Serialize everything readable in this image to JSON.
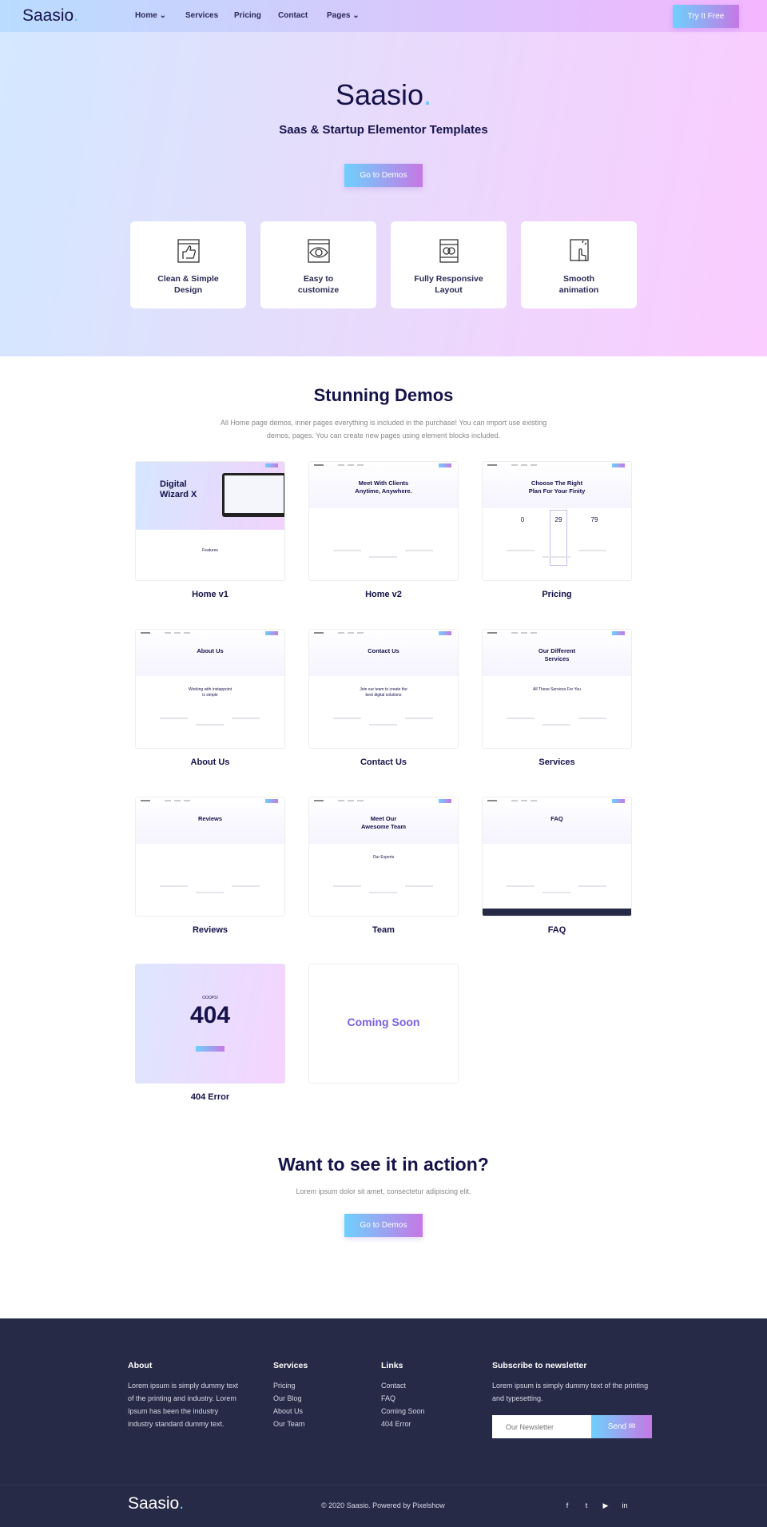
{
  "nav": {
    "logo": "Saasio",
    "logo_dot": ".",
    "items": [
      {
        "label": "Home",
        "dropdown": true
      },
      {
        "label": "Services"
      },
      {
        "label": "Pricing"
      },
      {
        "label": "Contact"
      },
      {
        "label": "Pages",
        "dropdown": true
      }
    ],
    "cta": "Try It Free"
  },
  "hero": {
    "title": "Saasio",
    "title_dot": ".",
    "subtitle": "Saas & Startup Elementor Templates",
    "button": "Go to Demos",
    "features": [
      {
        "icon": "thumbs-up-icon",
        "label": "Clean & Simple\nDesign"
      },
      {
        "icon": "eye-icon",
        "label": "Easy to\ncustomize"
      },
      {
        "icon": "responsive-layout-icon",
        "label": "Fully Responsive\nLayout"
      },
      {
        "icon": "touch-animation-icon",
        "label": "Smooth\nanimation"
      }
    ]
  },
  "demos": {
    "title": "Stunning Demos",
    "description": "All Home page demos, inner pages everything is included in the purchase! You can import use existing demos, pages. You can create new pages using element blocks included.",
    "items": [
      {
        "label": "Home v1",
        "heading": "Digital\nWizard X",
        "sub": "Features"
      },
      {
        "label": "Home v2",
        "heading": "Meet With Clients\nAnytime, Anywhere."
      },
      {
        "label": "Pricing",
        "heading": "Choose The Right\nPlan For Your Finity",
        "prices": [
          "0",
          "29",
          "79"
        ]
      },
      {
        "label": "About Us",
        "heading": "About Us",
        "sub": "Working with instappoint\nis simple"
      },
      {
        "label": "Contact Us",
        "heading": "Contact Us",
        "sub": "Join our team to create the\nbest digital solutions"
      },
      {
        "label": "Services",
        "heading": "Our Different\nServices",
        "sub": "All These Services For You"
      },
      {
        "label": "Reviews",
        "heading": "Reviews"
      },
      {
        "label": "Team",
        "heading": "Meet Our\nAwesome Team",
        "sub": "Our Experts"
      },
      {
        "label": "FAQ",
        "heading": "FAQ"
      },
      {
        "label": "404 Error",
        "heading": "404",
        "sub": "OOOPS!"
      },
      {
        "label": "",
        "heading": "Coming Soon"
      }
    ]
  },
  "cta": {
    "title": "Want to see it in action?",
    "text": "Lorem ipsum dolor sit amet, consectetur adipiscing elit.",
    "button": "Go to Demos"
  },
  "footer": {
    "about": {
      "title": "About",
      "text": "Lorem ipsum is simply dummy text of the printing and industry. Lorem Ipsum has been the industry industry standard dummy text."
    },
    "services": {
      "title": "Services",
      "links": [
        "Pricing",
        "Our Blog",
        "About Us",
        "Our Team"
      ]
    },
    "links": {
      "title": "Links",
      "links": [
        "Contact",
        "FAQ",
        "Coming Soon",
        "404 Error"
      ]
    },
    "newsletter": {
      "title": "Subscribe to newsletter",
      "text": "Lorem ipsum is simply dummy text of the printing and typesetting.",
      "placeholder": "Our Newsletter",
      "button": "Send"
    },
    "logo": "Saasio",
    "logo_dot": ".",
    "copyright": "© 2020 Saasio. Powered by Pixelshow",
    "social": [
      "facebook-icon",
      "twitter-icon",
      "youtube-icon",
      "linkedin-icon"
    ]
  },
  "colors": {
    "accent_start": "#6ed0fd",
    "accent_end": "#c678e4",
    "text_dark": "#16124a",
    "footer_bg": "#262a47",
    "logo_dot": "#5ac8fa"
  }
}
